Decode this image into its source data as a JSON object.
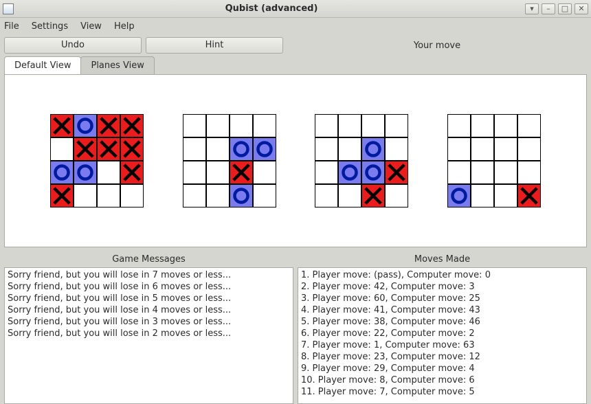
{
  "window": {
    "title": "Qubist (advanced)"
  },
  "menu": {
    "file": "File",
    "settings": "Settings",
    "view": "View",
    "help": "Help"
  },
  "toolbar": {
    "undo_label": "Undo",
    "hint_label": "Hint",
    "status_text": "Your move"
  },
  "tabs": {
    "default_label": "Default View",
    "planes_label": "Planes View",
    "active": "default"
  },
  "boards": [
    {
      "cells": [
        [
          "x",
          "o",
          "x",
          "x"
        ],
        [
          "",
          "x",
          "x",
          "x"
        ],
        [
          "o",
          "o",
          "",
          "x"
        ],
        [
          "x",
          "",
          "",
          ""
        ]
      ]
    },
    {
      "cells": [
        [
          "",
          "",
          "",
          ""
        ],
        [
          "",
          "",
          "o",
          "o"
        ],
        [
          "",
          "",
          "x",
          ""
        ],
        [
          "",
          "",
          "o",
          ""
        ]
      ]
    },
    {
      "cells": [
        [
          "",
          "",
          "",
          ""
        ],
        [
          "",
          "",
          "o",
          ""
        ],
        [
          "",
          "o",
          "o",
          "x"
        ],
        [
          "",
          "",
          "x",
          ""
        ]
      ]
    },
    {
      "cells": [
        [
          "",
          "",
          "",
          ""
        ],
        [
          "",
          "",
          "",
          ""
        ],
        [
          "",
          "",
          "",
          ""
        ],
        [
          "o",
          "",
          "",
          "x"
        ]
      ]
    }
  ],
  "panes": {
    "messages_header": "Game Messages",
    "moves_header": "Moves Made"
  },
  "messages": [
    "Sorry friend, but you will lose in 7 moves or less...",
    "Sorry friend, but you will lose in 6 moves or less...",
    "Sorry friend, but you will lose in 5 moves or less...",
    "Sorry friend, but you will lose in 4 moves or less...",
    "Sorry friend, but you will lose in 3 moves or less...",
    "Sorry friend, but you will lose in 2 moves or less..."
  ],
  "moves": [
    "1. Player move: (pass), Computer move: 0",
    "2. Player move: 42, Computer move: 3",
    "3. Player move: 60, Computer move: 25",
    "4. Player move: 41, Computer move: 43",
    "5. Player move: 38, Computer move: 46",
    "6. Player move: 22, Computer move: 2",
    "7. Player move: 1, Computer move: 63",
    "8. Player move: 23, Computer move: 12",
    "9. Player move: 29, Computer move: 4",
    "10. Player move: 8, Computer move: 6",
    "11. Player move: 7, Computer move: 5"
  ]
}
